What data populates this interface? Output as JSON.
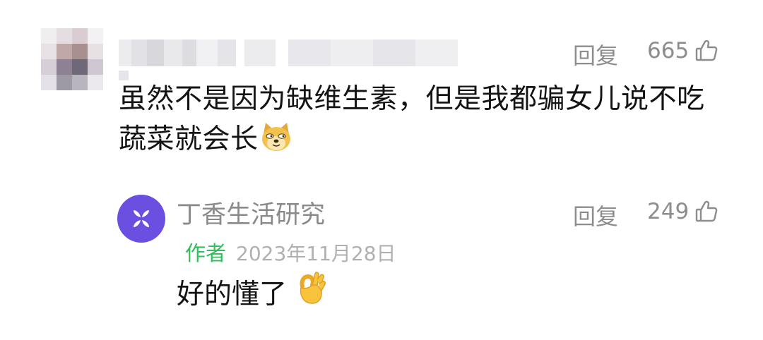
{
  "comment": {
    "username": "",
    "text": "虽然不是因为缺维生素，但是我都骗女儿说不吃蔬菜就会长",
    "emoji": "doge-icon",
    "reply_label": "回复",
    "like_count": "665",
    "like_icon": "thumbs-up-icon"
  },
  "reply": {
    "author_name": "丁香生活研究",
    "author_badge": "作者",
    "date": "2023年11月28日",
    "text": "好的懂了",
    "emoji": "ok-hand-icon",
    "reply_label": "回复",
    "like_count": "249",
    "like_icon": "thumbs-up-icon"
  },
  "colors": {
    "author_avatar": "#6b4fe0",
    "author_badge": "#2fbf5b",
    "meta_gray": "#8d8d8d"
  }
}
